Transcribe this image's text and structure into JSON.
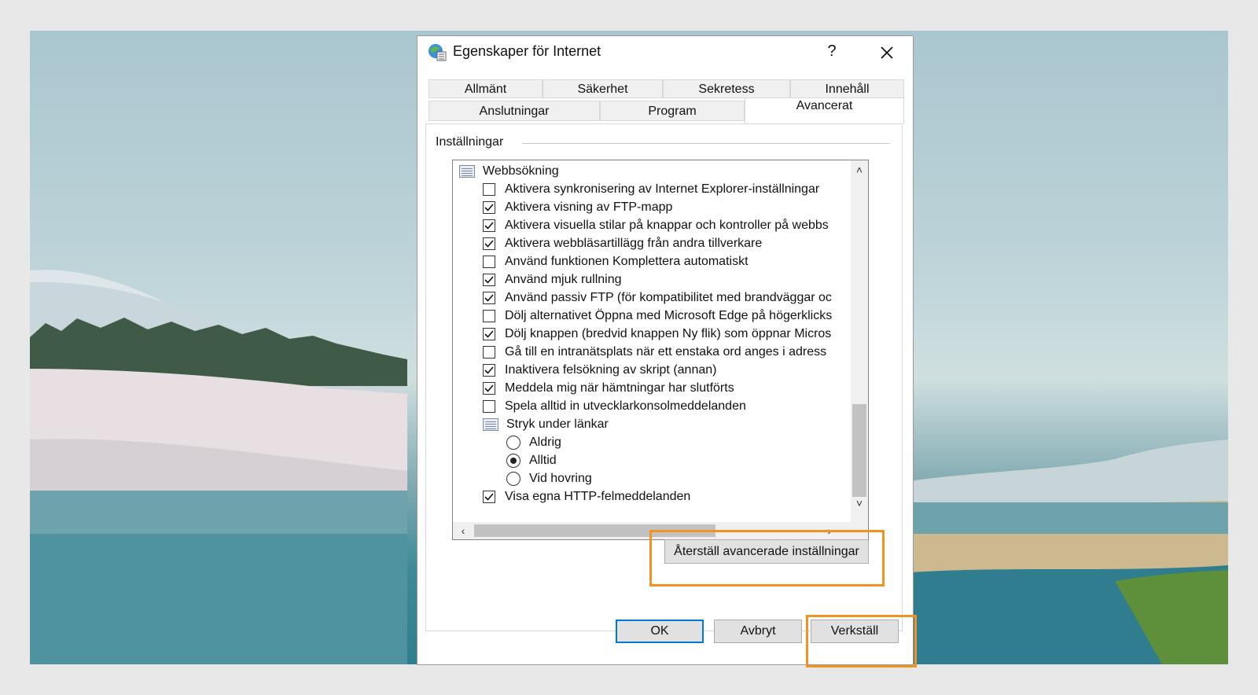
{
  "dialog": {
    "title": "Egenskaper för Internet",
    "help_label": "?",
    "close_icon": "close-icon"
  },
  "tabs": {
    "row1": [
      "Allmänt",
      "Säkerhet",
      "Sekretess",
      "Innehåll"
    ],
    "row2": [
      "Anslutningar",
      "Program",
      "Avancerat"
    ],
    "active": "Avancerat"
  },
  "settings": {
    "group_label": "Inställningar",
    "items": [
      {
        "kind": "folder",
        "label": "Webbsökning"
      },
      {
        "kind": "checkbox",
        "checked": false,
        "label": "Aktivera synkronisering av Internet Explorer-inställningar"
      },
      {
        "kind": "checkbox",
        "checked": true,
        "label": "Aktivera visning av FTP-mapp"
      },
      {
        "kind": "checkbox",
        "checked": true,
        "label": "Aktivera visuella stilar på knappar och kontroller på webbs"
      },
      {
        "kind": "checkbox",
        "checked": true,
        "label": "Aktivera webbläsartillägg från andra tillverkare"
      },
      {
        "kind": "checkbox",
        "checked": false,
        "label": "Använd funktionen Komplettera automatiskt"
      },
      {
        "kind": "checkbox",
        "checked": true,
        "label": "Använd mjuk rullning"
      },
      {
        "kind": "checkbox",
        "checked": true,
        "label": "Använd passiv FTP (för kompatibilitet med brandväggar oc"
      },
      {
        "kind": "checkbox",
        "checked": false,
        "label": "Dölj alternativet Öppna med Microsoft Edge på högerklicks"
      },
      {
        "kind": "checkbox",
        "checked": true,
        "label": "Dölj knappen (bredvid knappen Ny flik) som öppnar Micros"
      },
      {
        "kind": "checkbox",
        "checked": false,
        "label": "Gå till en intranätsplats när ett enstaka ord anges i adress"
      },
      {
        "kind": "checkbox",
        "checked": true,
        "label": "Inaktivera felsökning av skript (annan)"
      },
      {
        "kind": "checkbox",
        "checked": true,
        "label": "Meddela mig när hämtningar har slutförts"
      },
      {
        "kind": "checkbox",
        "checked": false,
        "label": "Spela alltid in utvecklarkonsolmeddelanden"
      },
      {
        "kind": "folder",
        "label": "Stryk under länkar"
      },
      {
        "kind": "radio",
        "checked": false,
        "label": "Aldrig"
      },
      {
        "kind": "radio",
        "checked": true,
        "label": "Alltid"
      },
      {
        "kind": "radio",
        "checked": false,
        "label": "Vid hovring"
      },
      {
        "kind": "checkbox",
        "checked": true,
        "label": "Visa egna HTTP-felmeddelanden"
      }
    ]
  },
  "buttons": {
    "reset_advanced": "Återställ avancerade inställningar",
    "ok": "OK",
    "cancel": "Avbryt",
    "apply": "Verkställ"
  },
  "colors": {
    "highlight": "#f29221",
    "default_button_border": "#0078d7"
  }
}
